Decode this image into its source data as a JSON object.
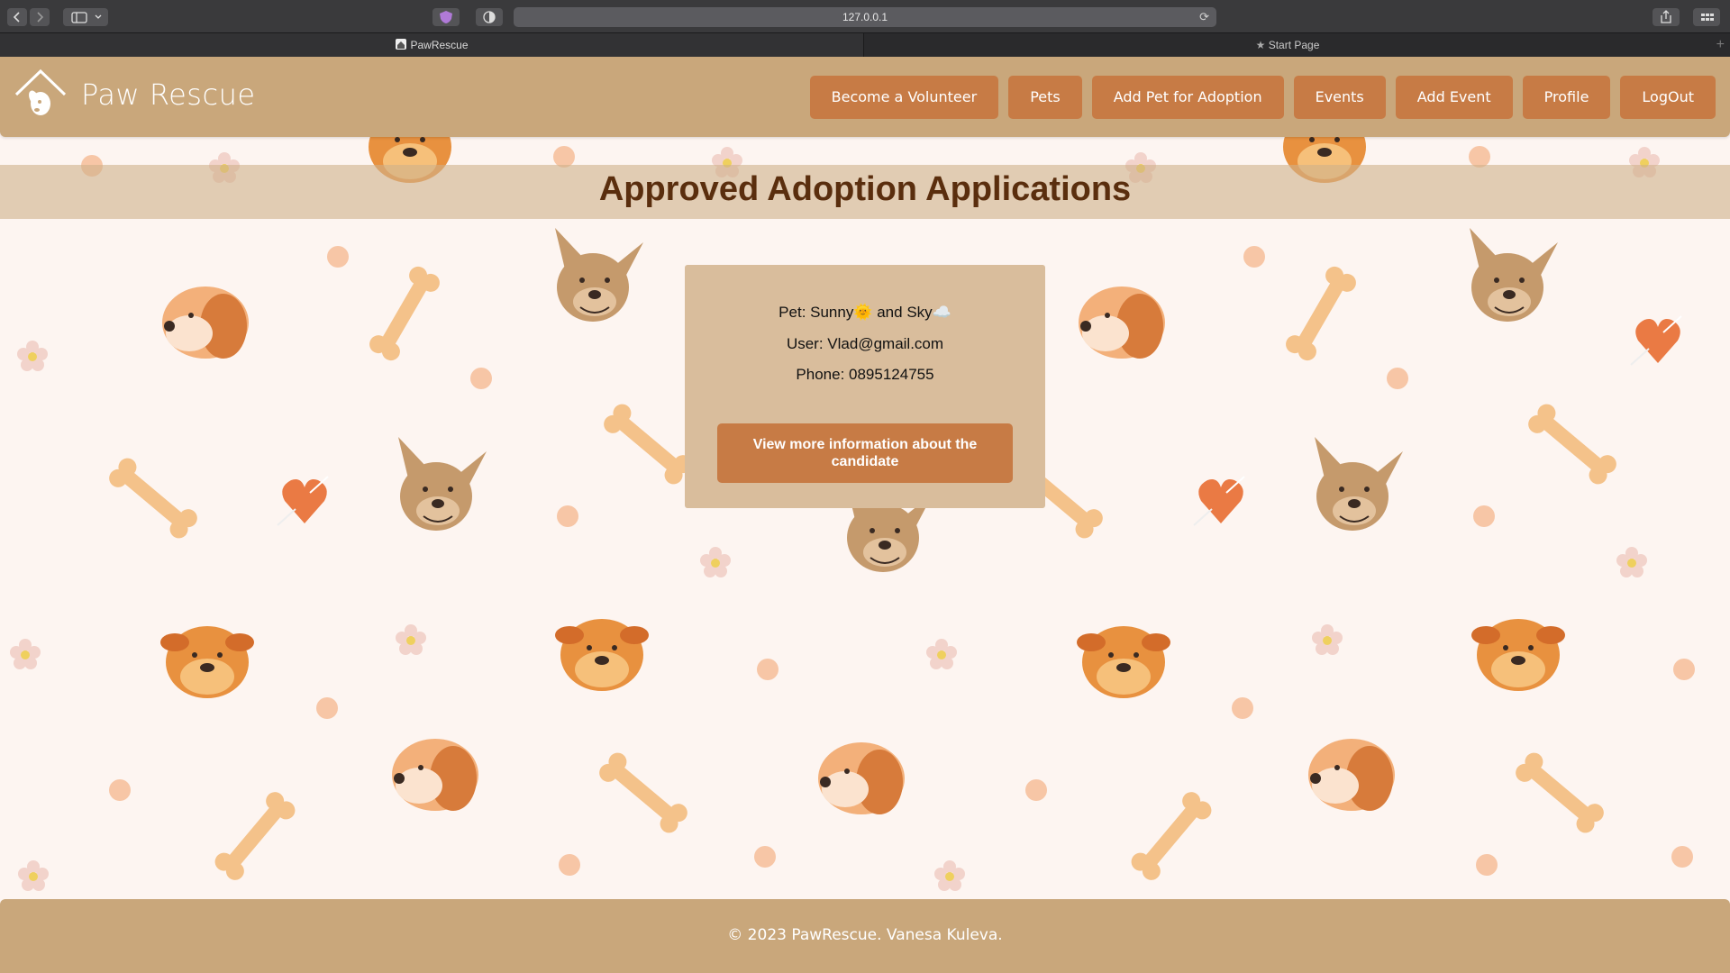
{
  "browser": {
    "url": "127.0.0.1",
    "tabs": [
      {
        "label": "PawRescue",
        "active": true
      },
      {
        "label": "Start Page",
        "active": false
      }
    ]
  },
  "navbar": {
    "brand": "Paw Rescue",
    "links": [
      {
        "label": "Become a Volunteer"
      },
      {
        "label": "Pets"
      },
      {
        "label": "Add Pet for Adoption"
      },
      {
        "label": "Events"
      },
      {
        "label": "Add Event"
      },
      {
        "label": "Profile"
      },
      {
        "label": "LogOut"
      }
    ]
  },
  "main": {
    "title": "Approved Adoption Applications",
    "applications": [
      {
        "pet_line": "Pet: Sunny🌞 and Sky☁️",
        "user_line": "User: Vlad@gmail.com",
        "phone_line": "Phone: 0895124755",
        "button_label": "View more information about the candidate"
      }
    ]
  },
  "footer": {
    "text": "© 2023 PawRescue. Vanesa Kuleva."
  },
  "colors": {
    "navbar_bg": "#c9a77b",
    "button_bg": "#c77b45",
    "title_color": "#5a2e0e",
    "page_bg": "#fdf5f1",
    "card_bg": "#d9bd9c"
  }
}
